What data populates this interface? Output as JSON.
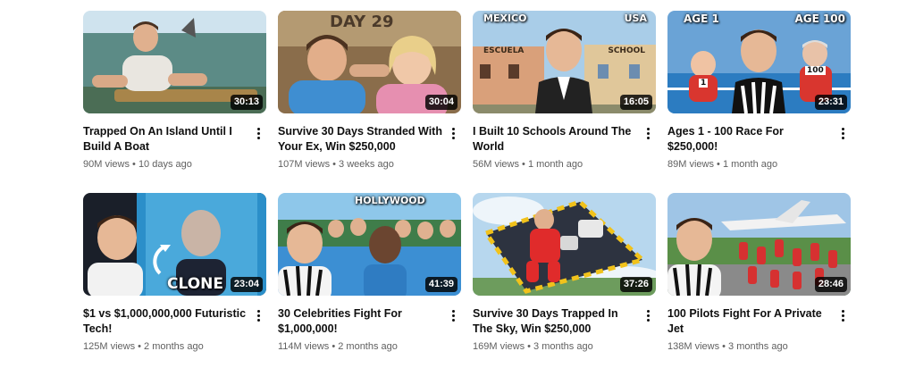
{
  "videos": [
    {
      "title": "Trapped On An Island Until I Build A Boat",
      "views": "90M views",
      "age": "10 days ago",
      "duration": "30:13"
    },
    {
      "title": "Survive 30 Days Stranded With Your Ex, Win $250,000",
      "views": "107M views",
      "age": "3 weeks ago",
      "duration": "30:04",
      "overlay": "DAY 29"
    },
    {
      "title": "I Built 10 Schools Around The World",
      "views": "56M views",
      "age": "1 month ago",
      "duration": "16:05",
      "overlay_left": "MEXICO",
      "overlay_right": "USA",
      "sign_left": "ESCUELA",
      "sign_right": "SCHOOL"
    },
    {
      "title": "Ages 1 - 100 Race For $250,000!",
      "views": "89M views",
      "age": "1 month ago",
      "duration": "23:31",
      "overlay_left": "AGE 1",
      "overlay_right": "AGE 100",
      "bib_left": "1",
      "bib_right": "100"
    },
    {
      "title": "$1 vs $1,000,000,000 Futuristic Tech!",
      "views": "125M views",
      "age": "2 months ago",
      "duration": "23:04",
      "overlay": "CLONE"
    },
    {
      "title": "30 Celebrities Fight For $1,000,000!",
      "views": "114M views",
      "age": "2 months ago",
      "duration": "41:39",
      "overlay": "HOLLYWOOD"
    },
    {
      "title": "Survive 30 Days Trapped In The Sky, Win $250,000",
      "views": "169M views",
      "age": "3 months ago",
      "duration": "37:26"
    },
    {
      "title": "100 Pilots Fight For A Private Jet",
      "views": "138M views",
      "age": "3 months ago",
      "duration": "28:46"
    }
  ]
}
